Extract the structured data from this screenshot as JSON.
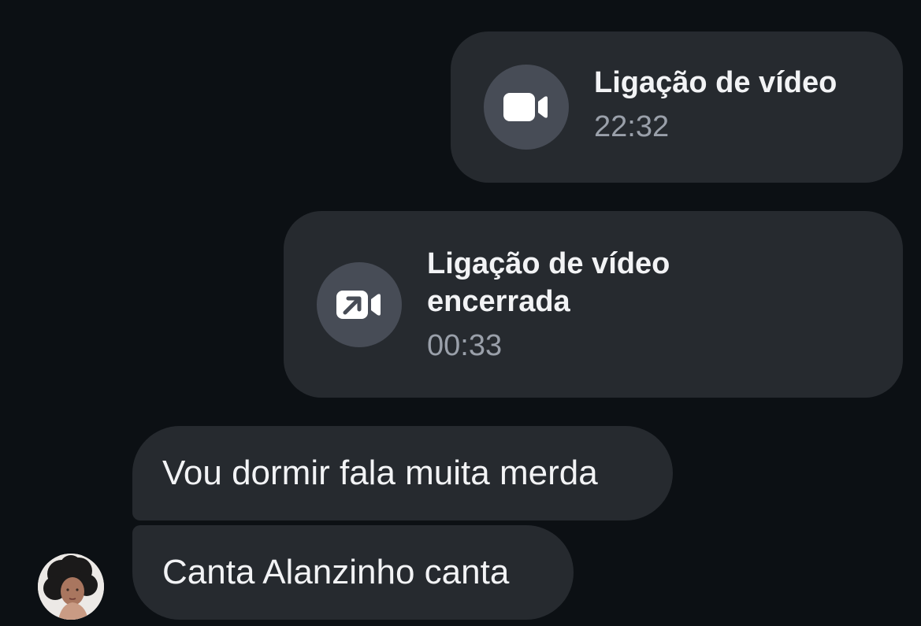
{
  "messages": {
    "video_call": {
      "icon": "video-camera-icon",
      "title": "Ligação de vídeo",
      "time": "22:32"
    },
    "video_call_ended": {
      "icon": "video-call-ended-icon",
      "title": "Ligação de vídeo encerrada",
      "time": "00:33"
    },
    "text_1": "Vou dormir fala muita merda",
    "text_2": "Canta Alanzinho canta"
  },
  "colors": {
    "background": "#0c1014",
    "bubble": "#262a2f",
    "icon_circle": "#474c56",
    "primary_text": "#f2f3f5",
    "secondary_text": "#9aa0aa"
  }
}
